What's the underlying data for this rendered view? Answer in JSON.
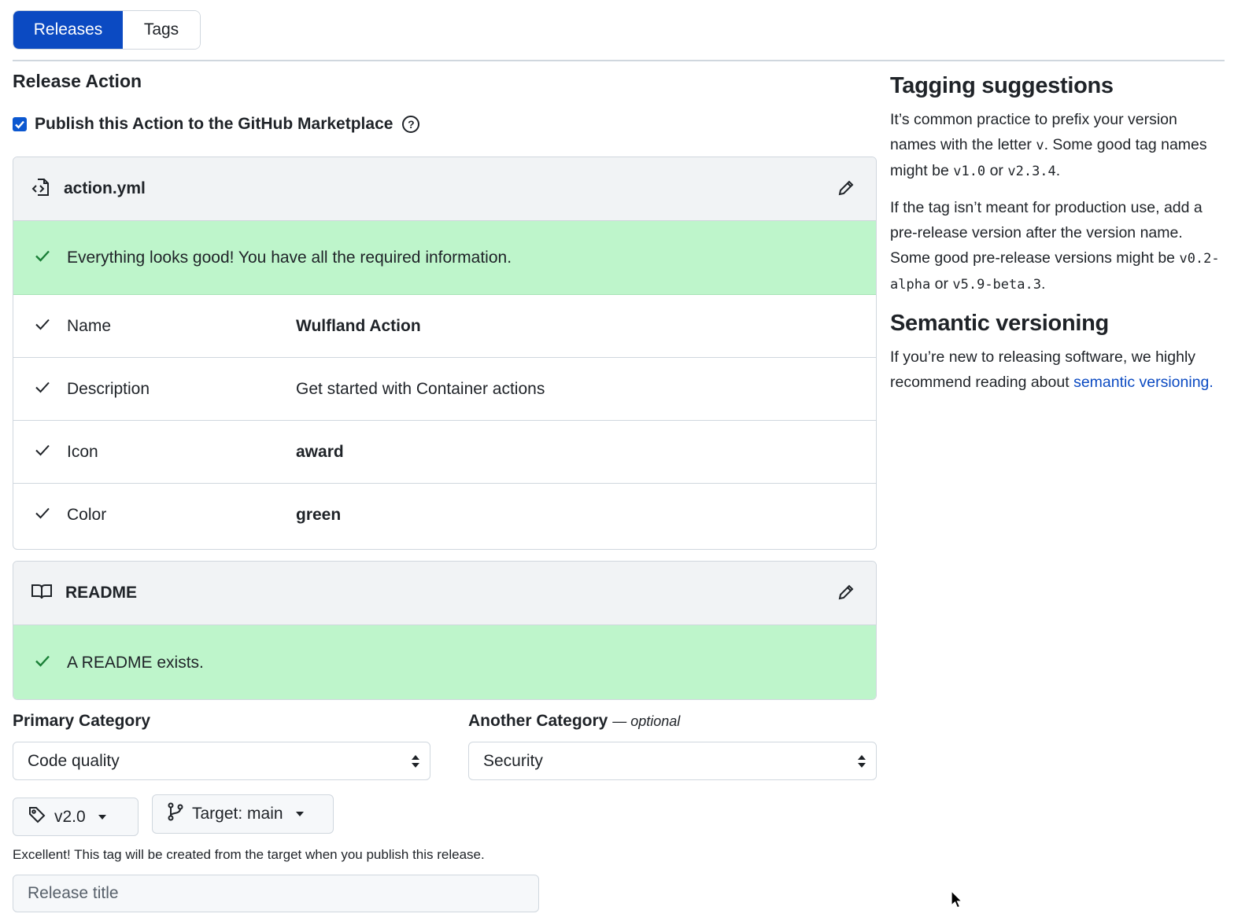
{
  "tabs": {
    "releases": "Releases",
    "tags": "Tags"
  },
  "section_title": "Release Action",
  "publish": {
    "label": "Publish this Action to the GitHub Marketplace",
    "checked": true,
    "help_glyph": "?"
  },
  "action_file": {
    "title": "action.yml",
    "success": "Everything looks good! You have all the required information.",
    "rows": [
      {
        "label": "Name",
        "value": "Wulfland Action"
      },
      {
        "label": "Description",
        "value": "Get started with Container actions"
      },
      {
        "label": "Icon",
        "value": "award"
      },
      {
        "label": "Color",
        "value": "green"
      }
    ]
  },
  "readme": {
    "title": "README",
    "success": "A README exists."
  },
  "categories": {
    "primary_label": "Primary Category",
    "primary_value": "Code quality",
    "another_label": "Another Category",
    "another_optional": "— optional",
    "another_value": "Security"
  },
  "tag_button": {
    "label": "v2.0"
  },
  "target_button": {
    "label": "Target: main"
  },
  "tag_note": "Excellent! This tag will be created from the target when you publish this release.",
  "release_title": {
    "placeholder": "Release title"
  },
  "sidebar": {
    "tagging_heading": "Tagging suggestions",
    "tagging_p1_a": "It’s common practice to prefix your version names with the letter ",
    "tagging_p1_code1": "v",
    "tagging_p1_b": ". Some good tag names might be ",
    "tagging_p1_code2": "v1.0",
    "tagging_p1_c": " or ",
    "tagging_p1_code3": "v2.3.4",
    "tagging_p1_d": ".",
    "tagging_p2_a": "If the tag isn’t meant for production use, add a pre-release version after the version name. Some good pre-release versions might be ",
    "tagging_p2_code1": "v0.2-alpha",
    "tagging_p2_b": " or ",
    "tagging_p2_code2": "v5.9-beta.3",
    "tagging_p2_c": ".",
    "semver_heading": "Semantic versioning",
    "semver_p_a": "If you’re new to releasing software, we highly recommend reading about ",
    "semver_link": "semantic versioning",
    "semver_p_b": "."
  },
  "colors": {
    "accent": "#0b4ac2",
    "success_bg": "#bef5cb",
    "success_icon": "#1a7f37"
  }
}
